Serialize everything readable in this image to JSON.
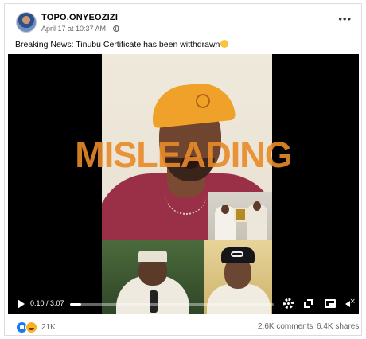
{
  "post": {
    "page_name": "TOPO.ONYEOZIZI",
    "timestamp": "April 17 at 10:37 AM",
    "separator": "·",
    "privacy_icon": "globe-icon",
    "more_icon": "more-options-icon",
    "more_label": "•••",
    "text": "Breaking News: Tinubu Certificate has been witthdrawn",
    "emoji": "laughing-face-emoji"
  },
  "video": {
    "overlay_label": "MISLEADING",
    "overlay_color": "#e98928",
    "current_time": "0:10",
    "duration": "3:07",
    "time_display": "0:10 / 3:07",
    "progress_fraction": 0.053,
    "controls": {
      "play_icon": "play-icon",
      "settings_icon": "gear-icon",
      "expand_icon": "expand-icon",
      "pip_icon": "picture-in-picture-icon",
      "mute_icon": "muted-speaker-icon"
    }
  },
  "footer": {
    "reaction_icons": [
      "like-reaction-icon",
      "haha-reaction-icon"
    ],
    "reaction_count": "21K",
    "comments": "2.6K comments",
    "shares": "6.4K shares"
  },
  "colors": {
    "accent_blue": "#1877f2",
    "muted_text": "#65676b"
  }
}
